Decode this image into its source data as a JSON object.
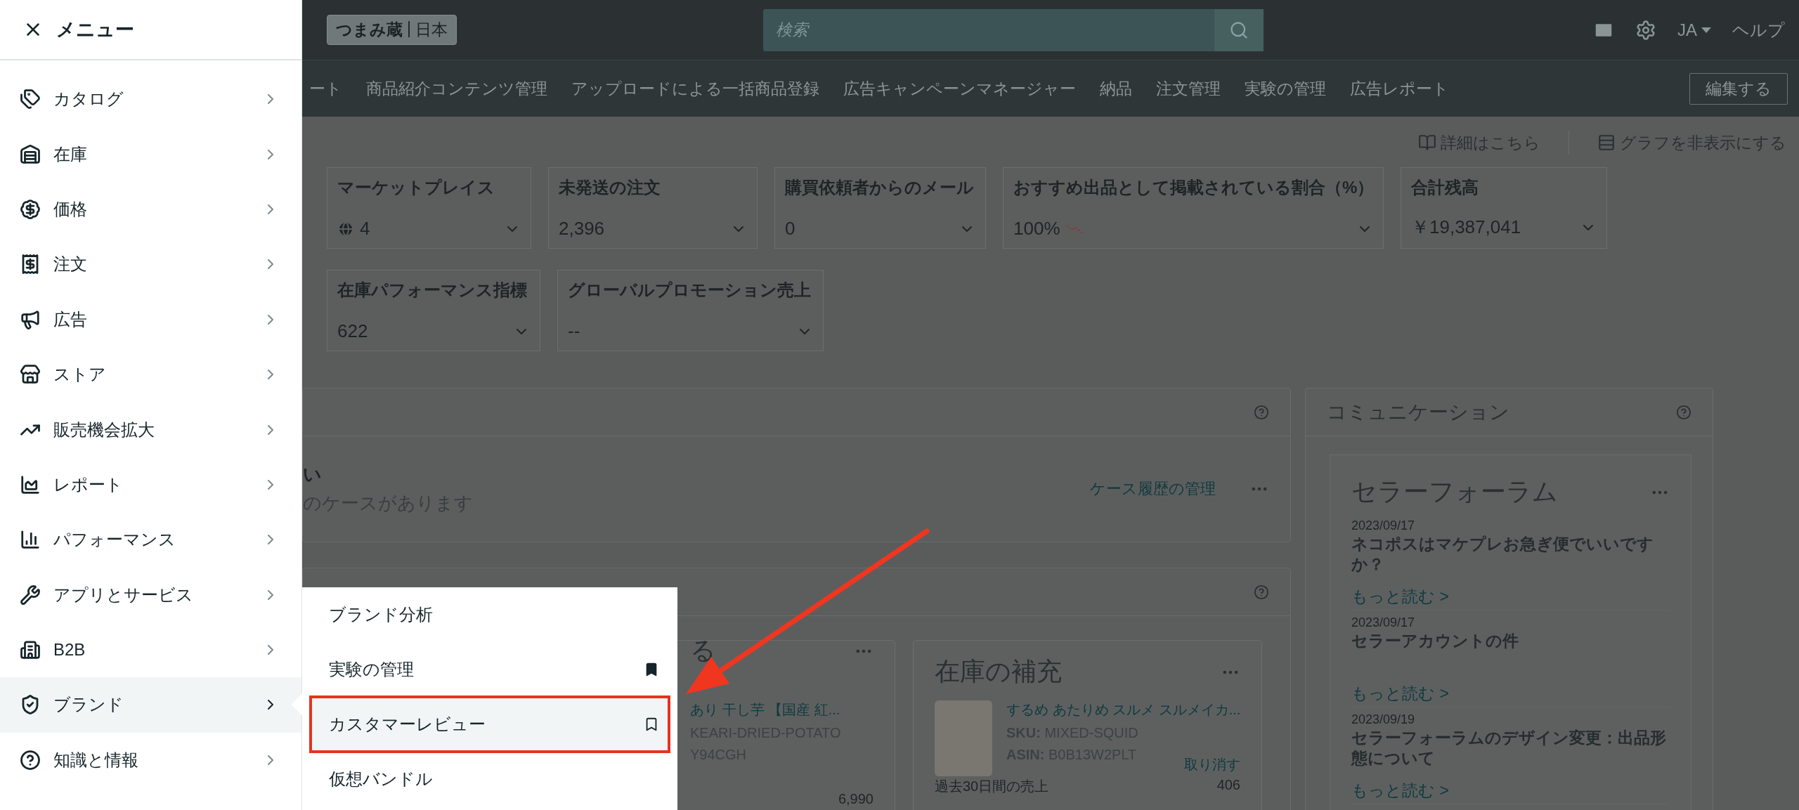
{
  "header": {
    "store_name": "つまみ蔵",
    "store_separator": "|",
    "store_region": "日本",
    "search": {
      "placeholder": "検索"
    },
    "language": "JA",
    "help": "ヘルプ"
  },
  "nav": {
    "items": [
      "ート",
      "商品紹介コンテンツ管理",
      "アップロードによる一括商品登録",
      "広告キャンペーンマネージャー",
      "納品",
      "注文管理",
      "実験の管理",
      "広告レポート"
    ],
    "edit_button": "編集する"
  },
  "toolbar": {
    "learn_more": "詳細はこちら",
    "hide_graph": "グラフを非表示にする"
  },
  "metric_rows": [
    [
      {
        "title": "マーケットプレイス",
        "value": "4",
        "kind": "globe"
      },
      {
        "title": "未発送の注文",
        "value": "2,396",
        "kind": "plain"
      },
      {
        "title": "購買依頼者からのメール",
        "value": "0",
        "kind": "plain"
      },
      {
        "title": "おすすめ出品として掲載されている割合（%）",
        "value": "100%",
        "kind": "trend"
      },
      {
        "title": "合計残高",
        "value": "￥19,387,041",
        "kind": "plain"
      }
    ],
    [
      {
        "title": "在庫パフォーマンス指標",
        "value": "622",
        "kind": "plain"
      },
      {
        "title": "グローバルプロモーション売上",
        "value": "--",
        "kind": "plain"
      }
    ]
  ],
  "cases_panel": {
    "title": "い",
    "subtitle": "のケースがあります",
    "link": "ケース履歴の管理"
  },
  "sales_panel": {
    "left_card": {
      "title": "る",
      "product": "あり 干し芋 【国産 紅...",
      "sku": "KEARI-DRIED-POTATO",
      "asin": "Y94CGH",
      "value": "6,990"
    },
    "restock_card": {
      "title": "在庫の補充",
      "product": "するめ あたりめ スルメ スルメイカ...",
      "sku_label": "SKU:",
      "sku": "MIXED-SQUID",
      "asin_label": "ASIN:",
      "asin": "B0B13W2PLT",
      "action": "取り消す",
      "sales_label": "過去30日間の売上",
      "sales_value": "406"
    }
  },
  "communication": {
    "title": "コミュニケーション",
    "forum": {
      "title": "セラーフォーラム",
      "posts": [
        {
          "date": "2023/09/17",
          "title": "ネコポスはマケプレお急ぎ便でいいですか？",
          "link": "もっと読む >"
        },
        {
          "date": "2023/09/17",
          "title": "セラーアカウントの件",
          "link": "もっと読む >"
        },
        {
          "date": "2023/09/19",
          "title": "セラーフォーラムのデザイン変更：出品形態について",
          "link": "もっと読む >"
        }
      ]
    }
  },
  "menu": {
    "title": "メニュー",
    "items": [
      {
        "label": "カタログ",
        "selected": false
      },
      {
        "label": "在庫",
        "selected": false
      },
      {
        "label": "価格",
        "selected": false
      },
      {
        "label": "注文",
        "selected": false
      },
      {
        "label": "広告",
        "selected": false
      },
      {
        "label": "ストア",
        "selected": false
      },
      {
        "label": "販売機会拡大",
        "selected": false
      },
      {
        "label": "レポート",
        "selected": false
      },
      {
        "label": "パフォーマンス",
        "selected": false
      },
      {
        "label": "アプリとサービス",
        "selected": false
      },
      {
        "label": "B2B",
        "selected": false
      },
      {
        "label": "ブランド",
        "selected": true
      },
      {
        "label": "知識と情報",
        "selected": false
      }
    ]
  },
  "submenu": {
    "items": [
      {
        "label": "ブランド分析",
        "selected": false,
        "pinned": false
      },
      {
        "label": "実験の管理",
        "selected": false,
        "pinned": true
      },
      {
        "label": "カスタマーレビュー",
        "selected": true,
        "pinned": false
      },
      {
        "label": "仮想バンドル",
        "selected": false,
        "pinned": false
      }
    ]
  }
}
